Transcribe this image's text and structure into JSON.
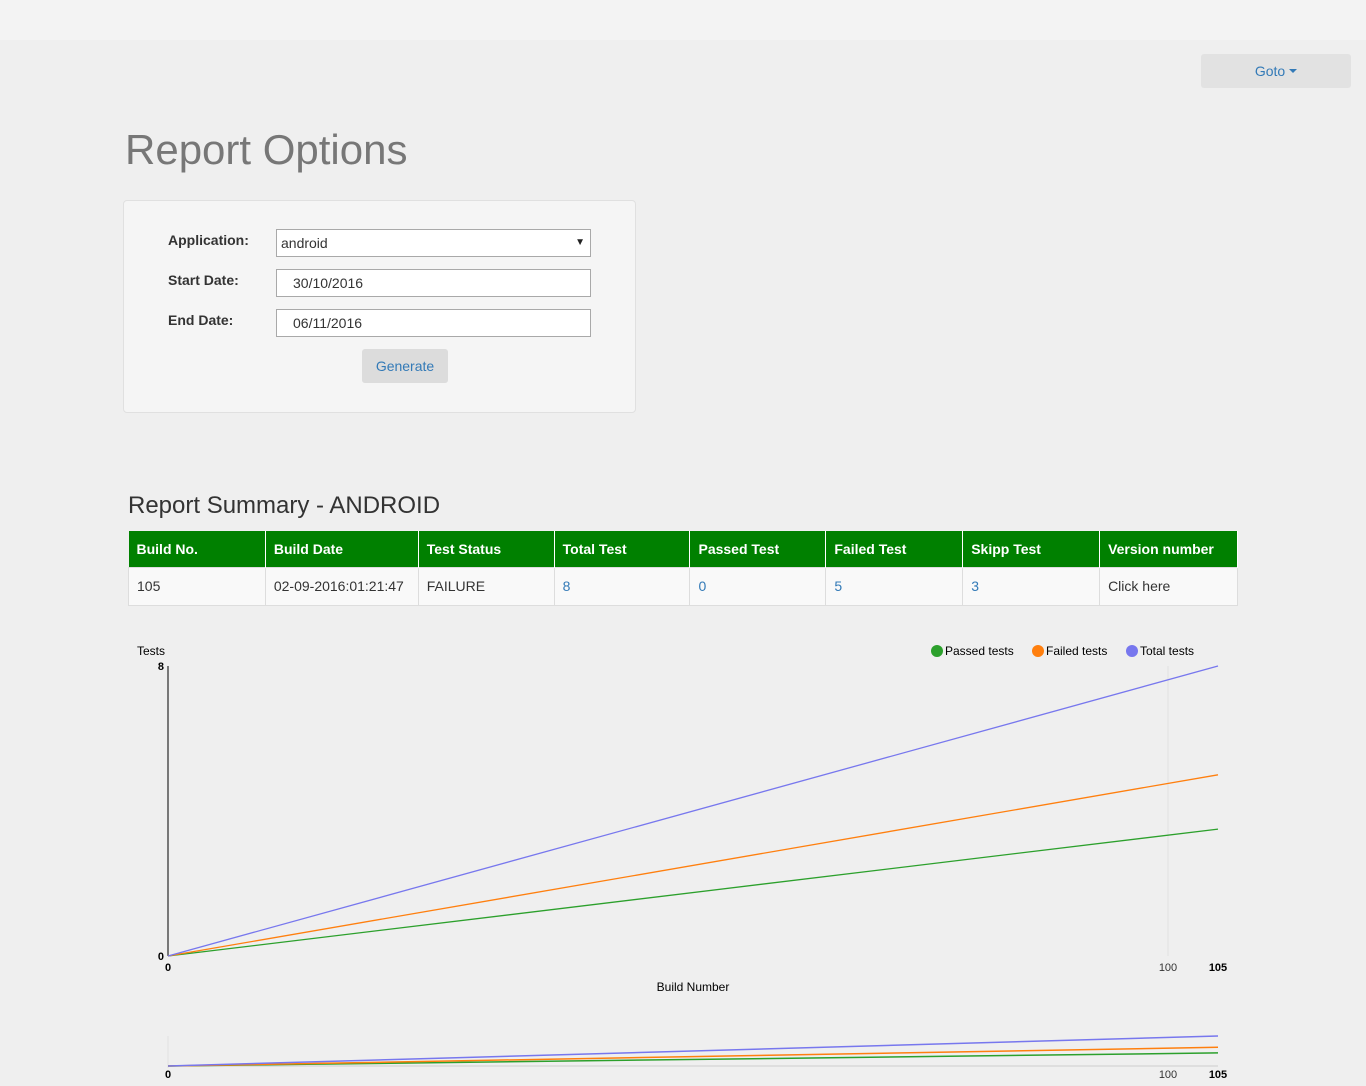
{
  "header": {
    "goto_label": "Goto"
  },
  "report_options": {
    "title": "Report Options",
    "application_label": "Application:",
    "application_value": "android",
    "start_date_label": "Start Date:",
    "start_date_value": "30/10/2016",
    "end_date_label": "End Date:",
    "end_date_value": "06/11/2016",
    "generate_label": "Generate"
  },
  "summary": {
    "title": "Report Summary - ANDROID",
    "columns": [
      "Build No.",
      "Build Date",
      "Test Status",
      "Total Test",
      "Passed Test",
      "Failed Test",
      "Skipp Test",
      "Version number"
    ],
    "rows": [
      [
        "105",
        "02-09-2016:01:21:47",
        "FAILURE",
        "8",
        "0",
        "5",
        "3",
        "Click here"
      ]
    ]
  },
  "colors": {
    "passed": "#2ca02c",
    "failed": "#ff7f0e",
    "total": "#7777ee",
    "header_green": "#008000"
  },
  "chart_data": {
    "type": "line",
    "ylabel": "Tests",
    "xlabel": "Build Number",
    "xlim": [
      0,
      105
    ],
    "ylim": [
      0,
      8
    ],
    "x_ticks": [
      "0",
      "100",
      "105"
    ],
    "y_ticks": [
      "0",
      "8"
    ],
    "legend_position": "top-right",
    "series": [
      {
        "name": "Passed tests",
        "color": "#2ca02c",
        "x": [
          0,
          105
        ],
        "y": [
          0,
          3.5
        ]
      },
      {
        "name": "Failed tests",
        "color": "#ff7f0e",
        "x": [
          0,
          105
        ],
        "y": [
          0,
          5
        ]
      },
      {
        "name": "Total tests",
        "color": "#7777ee",
        "x": [
          0,
          105
        ],
        "y": [
          0,
          8
        ]
      }
    ]
  }
}
